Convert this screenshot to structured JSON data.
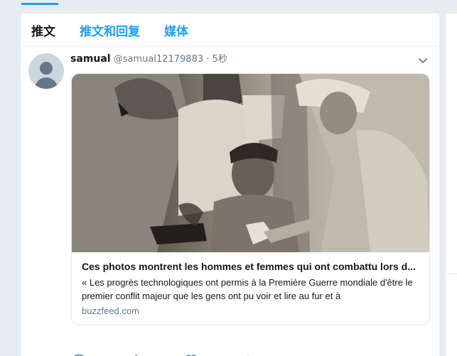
{
  "tabs": [
    {
      "label": "推文",
      "active": true
    },
    {
      "label": "推文和回复",
      "active": false
    },
    {
      "label": "媒体",
      "active": false
    }
  ],
  "tweet": {
    "display_name": "samual",
    "handle": "@samual12179883",
    "separator": "·",
    "time": "5秒",
    "card": {
      "title": "Ces photos montrent les hommes et femmes qui ont combattu lors d...",
      "description": "« Les progrès technologiques ont permis à la Première Guerre mondiale d'être le premier conflit majeur que les gens ont pu voir et lire au fur et à",
      "domain": "buzzfeed.com",
      "image_icon": "sepia-photo-nurses-treating-soldier"
    },
    "actions": [
      {
        "name": "reply",
        "icon": "speech-bubble-icon"
      },
      {
        "name": "retweet",
        "icon": "retweet-arrows-icon"
      },
      {
        "name": "like",
        "icon": "heart-icon"
      },
      {
        "name": "analytics",
        "icon": "bar-chart-icon"
      }
    ]
  },
  "colors": {
    "accent": "#1da1f2",
    "background": "#e6ecf0",
    "text_primary": "#14171a",
    "text_secondary": "#657786"
  }
}
